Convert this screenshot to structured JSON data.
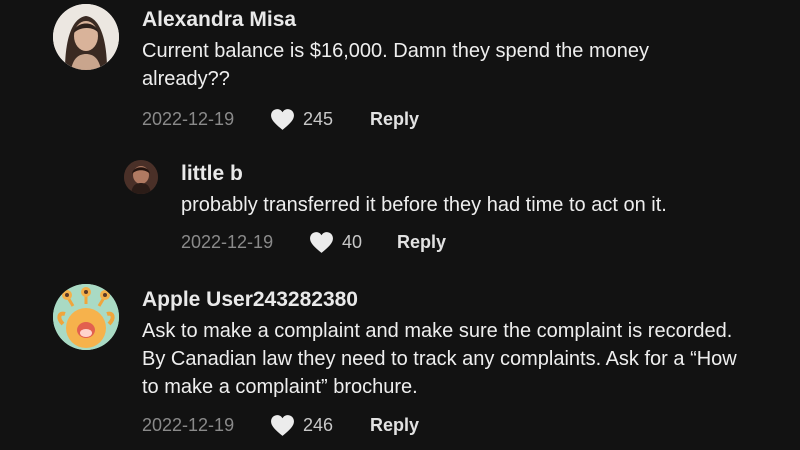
{
  "comments": [
    {
      "username": "Alexandra Misa",
      "text": "Current balance is $16,000. Damn they spend the money already??",
      "date": "2022-12-19",
      "likes": "245",
      "reply_label": "Reply"
    },
    {
      "username": "little b",
      "text": "probably transferred it before they had time to act on it.",
      "date": "2022-12-19",
      "likes": "40",
      "reply_label": "Reply"
    },
    {
      "username": "Apple User243282380",
      "text": "Ask to make a complaint and make sure the complaint is recorded. By Canadian law they need to track any complaints. Ask for a “How to make a complaint” brochure.",
      "date": "2022-12-19",
      "likes": "246",
      "reply_label": "Reply"
    }
  ],
  "icons": {
    "like": "heart-icon"
  },
  "colors": {
    "background": "#121212",
    "username": "#e9e9e9",
    "body_text": "#eeeeee",
    "date": "#8a8a8a",
    "heart": "#ececec"
  }
}
